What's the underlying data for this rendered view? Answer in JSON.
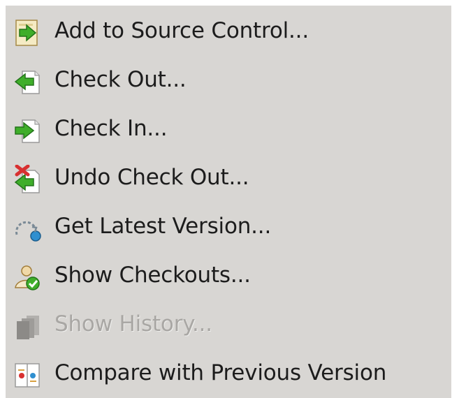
{
  "menu": {
    "items": [
      {
        "label": "Add to Source Control...",
        "icon": "add-to-source-control-icon",
        "enabled": true
      },
      {
        "label": "Check Out...",
        "icon": "check-out-icon",
        "enabled": true
      },
      {
        "label": "Check In...",
        "icon": "check-in-icon",
        "enabled": true
      },
      {
        "label": "Undo Check Out...",
        "icon": "undo-check-out-icon",
        "enabled": true
      },
      {
        "label": "Get Latest Version...",
        "icon": "get-latest-version-icon",
        "enabled": true
      },
      {
        "label": "Show Checkouts...",
        "icon": "show-checkouts-icon",
        "enabled": true
      },
      {
        "label": "Show History...",
        "icon": "show-history-icon",
        "enabled": false
      },
      {
        "label": "Compare with Previous Version",
        "icon": "compare-icon",
        "enabled": true
      }
    ]
  },
  "colors": {
    "menu_background": "#d8d6d3",
    "text": "#1c1c1c",
    "disabled_text": "#a9a7a4",
    "arrow_green": "#3fae2a",
    "undo_red": "#d83030"
  }
}
